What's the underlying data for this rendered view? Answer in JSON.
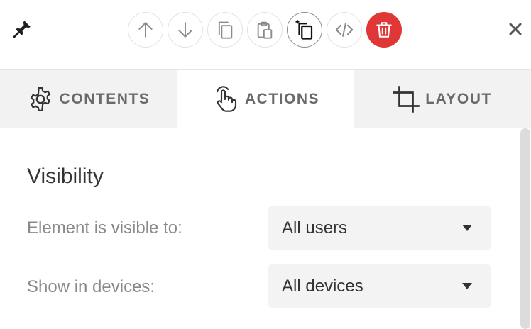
{
  "toolbar": {
    "icons": [
      "pin-icon",
      "move-up-icon",
      "move-down-icon",
      "duplicate-icon",
      "paste-icon",
      "copy-style-icon",
      "code-icon",
      "trash-icon",
      "close-icon"
    ],
    "colors": {
      "danger": "#e03636",
      "icon": "#8a8a8a"
    }
  },
  "tabs": [
    {
      "label": "CONTENTS",
      "icon": "gear-icon"
    },
    {
      "label": "ACTIONS",
      "icon": "hand-pointer-icon",
      "active": true
    },
    {
      "label": "LAYOUT",
      "icon": "crop-icon"
    }
  ],
  "visibility": {
    "title": "Visibility",
    "visible_to": {
      "label": "Element is visible to:",
      "value": "All users"
    },
    "devices": {
      "label": "Show in devices:",
      "value": "All devices"
    }
  }
}
